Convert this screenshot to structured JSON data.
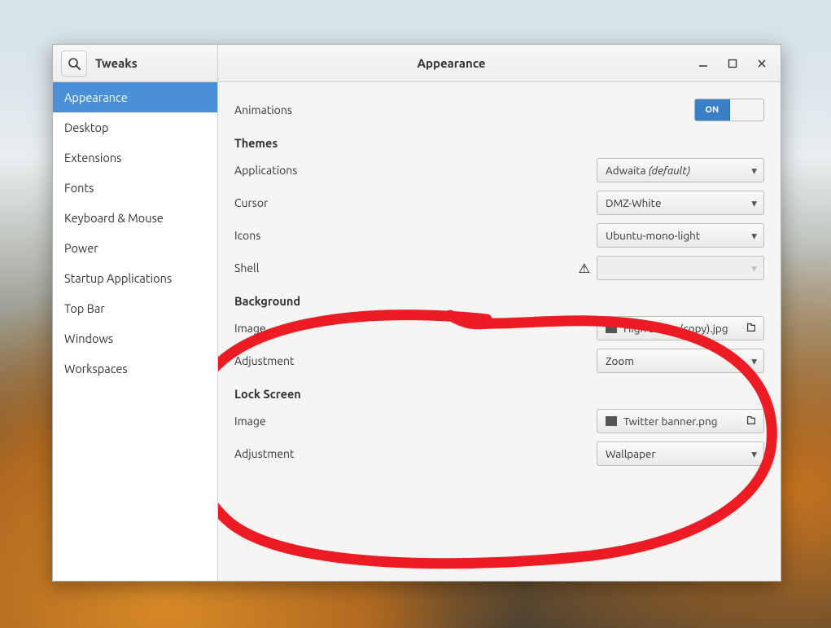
{
  "header": {
    "brand": "Tweaks",
    "title": "Appearance"
  },
  "sidebar": {
    "items": [
      {
        "label": "Appearance",
        "selected": true
      },
      {
        "label": "Desktop"
      },
      {
        "label": "Extensions"
      },
      {
        "label": "Fonts"
      },
      {
        "label": "Keyboard & Mouse"
      },
      {
        "label": "Power"
      },
      {
        "label": "Startup Applications"
      },
      {
        "label": "Top Bar"
      },
      {
        "label": "Windows"
      },
      {
        "label": "Workspaces"
      }
    ]
  },
  "content": {
    "animations": {
      "label": "Animations",
      "toggle_on": "ON"
    },
    "themes": {
      "title": "Themes",
      "applications": {
        "label": "Applications",
        "value": "Adwaita",
        "suffix": "(default)"
      },
      "cursor": {
        "label": "Cursor",
        "value": "DMZ-White"
      },
      "icons": {
        "label": "Icons",
        "value": "Ubuntu-mono-light"
      },
      "shell": {
        "label": "Shell",
        "value": ""
      }
    },
    "background": {
      "title": "Background",
      "image": {
        "label": "Image",
        "value": "High Sierra (copy).jpg"
      },
      "adjustment": {
        "label": "Adjustment",
        "value": "Zoom"
      }
    },
    "lockscreen": {
      "title": "Lock Screen",
      "image": {
        "label": "Image",
        "value": "Twitter banner.png"
      },
      "adjustment": {
        "label": "Adjustment",
        "value": "Wallpaper"
      }
    }
  }
}
